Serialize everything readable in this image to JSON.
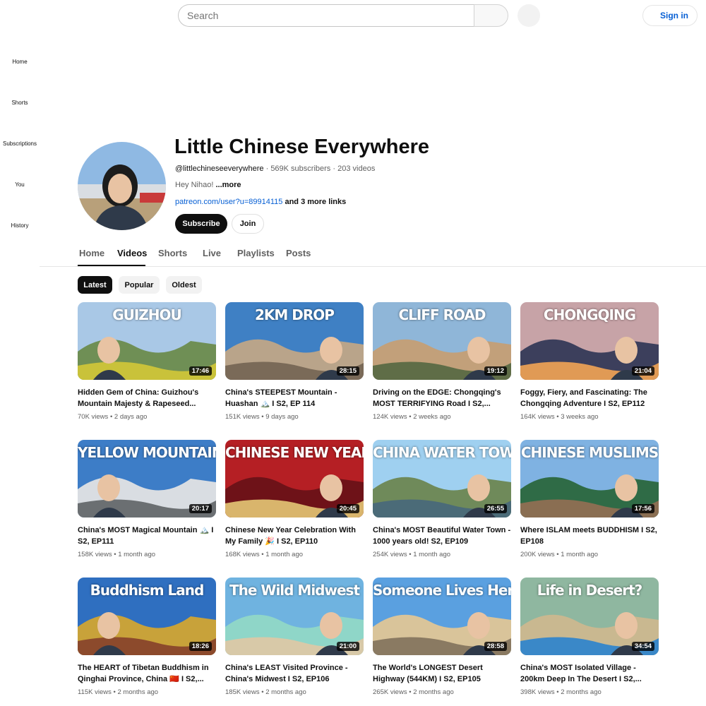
{
  "search": {
    "placeholder": "Search"
  },
  "header": {
    "sign_in_label": "Sign in"
  },
  "sidebar": {
    "items": [
      {
        "label": "Home"
      },
      {
        "label": "Shorts"
      },
      {
        "label": "Subscriptions"
      },
      {
        "label": "You"
      },
      {
        "label": "History"
      }
    ]
  },
  "channel": {
    "name": "Little Chinese Everywhere",
    "handle": "@littlechineseeverywhere",
    "subscribers": "569K subscribers",
    "videos_count": "203 videos",
    "separator": "·",
    "description": "Hey Nihao!",
    "more_label": "...more",
    "link": "patreon.com/user?u=89914115",
    "more_links": "and 3 more links",
    "subscribe_label": "Subscribe",
    "join_label": "Join"
  },
  "tabs": [
    {
      "label": "Home"
    },
    {
      "label": "Videos",
      "active": true
    },
    {
      "label": "Shorts"
    },
    {
      "label": "Live"
    },
    {
      "label": "Playlists"
    },
    {
      "label": "Posts"
    }
  ],
  "chips": [
    {
      "label": "Latest",
      "active": true
    },
    {
      "label": "Popular"
    },
    {
      "label": "Oldest"
    }
  ],
  "videos": [
    {
      "thumb_text": "GUIZHOU",
      "duration": "17:46",
      "title": "Hidden Gem of China: Guizhou's Mountain Majesty & Rapeseed...",
      "views": "70K views",
      "age": "2 days ago",
      "colors": [
        "#a9c8e6",
        "#6f8f55",
        "#c9c23a"
      ]
    },
    {
      "thumb_text": "2KM DROP",
      "duration": "28:15",
      "title": "China's STEEPEST Mountain - Huashan 🏔️ I S2, EP 114",
      "views": "151K views",
      "age": "9 days ago",
      "colors": [
        "#3f80c4",
        "#b9a48a",
        "#7a6a58"
      ]
    },
    {
      "thumb_text": "CLIFF ROAD",
      "duration": "19:12",
      "title": "Driving on the EDGE: Chongqing's MOST TERRIFYING Road I S2,...",
      "views": "124K views",
      "age": "2 weeks ago",
      "colors": [
        "#8fb6d8",
        "#c2a07a",
        "#5f6d47"
      ]
    },
    {
      "thumb_text": "CHONGQING",
      "duration": "21:04",
      "title": "Foggy, Fiery, and Fascinating: The Chongqing Adventure I S2, EP112",
      "views": "164K views",
      "age": "3 weeks ago",
      "colors": [
        "#c7a3a7",
        "#3c3f5c",
        "#e09a55"
      ]
    },
    {
      "thumb_text": "YELLOW MOUNTAIN",
      "duration": "20:17",
      "title": "China's MOST Magical Mountain 🏔️ I S2, EP111",
      "views": "158K views",
      "age": "1 month ago",
      "colors": [
        "#3d7dc7",
        "#d9dde2",
        "#6b6f72"
      ]
    },
    {
      "thumb_text": "CHINESE NEW YEAR",
      "duration": "20:45",
      "title": "Chinese New Year Celebration With My Family 🎉 I S2, EP110",
      "views": "168K views",
      "age": "1 month ago",
      "colors": [
        "#b51f24",
        "#6e1218",
        "#d9b56c"
      ]
    },
    {
      "thumb_text": "CHINA WATER TOWN",
      "duration": "26:55",
      "title": "China's MOST Beautiful Water Town - 1000 years old! S2, EP109",
      "views": "254K views",
      "age": "1 month ago",
      "colors": [
        "#9fd0f0",
        "#6f8a5a",
        "#4b6b78"
      ]
    },
    {
      "thumb_text": "CHINESE MUSLIMS",
      "duration": "17:56",
      "title": "Where ISLAM meets BUDDHISM I S2, EP108",
      "views": "200K views",
      "age": "1 month ago",
      "colors": [
        "#7fb2e2",
        "#2f6b46",
        "#8a6e52"
      ]
    },
    {
      "thumb_text": "Buddhism Land",
      "duration": "18:26",
      "title": "The HEART of Tibetan Buddhism in Qinghai Province, China 🇨🇳 I S2,...",
      "views": "115K views",
      "age": "2 months ago",
      "colors": [
        "#2f6fc0",
        "#c8a23a",
        "#8c4a2c"
      ]
    },
    {
      "thumb_text": "The Wild Midwest",
      "duration": "21:00",
      "title": "China's LEAST Visited Province - China's Midwest I S2, EP106",
      "views": "185K views",
      "age": "2 months ago",
      "colors": [
        "#6fb3e0",
        "#8fd6c8",
        "#d8c9a8"
      ]
    },
    {
      "thumb_text": "Someone Lives Here ALONE",
      "duration": "28:58",
      "title": "The World's LONGEST Desert Highway (544KM) I S2, EP105",
      "views": "265K views",
      "age": "2 months ago",
      "colors": [
        "#5aa0e0",
        "#d9c49a",
        "#8a7a62"
      ]
    },
    {
      "thumb_text": "Life in Desert?",
      "duration": "34:54",
      "title": "China's MOST Isolated Village - 200km Deep In The Desert I S2,...",
      "views": "398K views",
      "age": "2 months ago",
      "colors": [
        "#8fb7a0",
        "#c9b890",
        "#3a88c8"
      ]
    }
  ]
}
